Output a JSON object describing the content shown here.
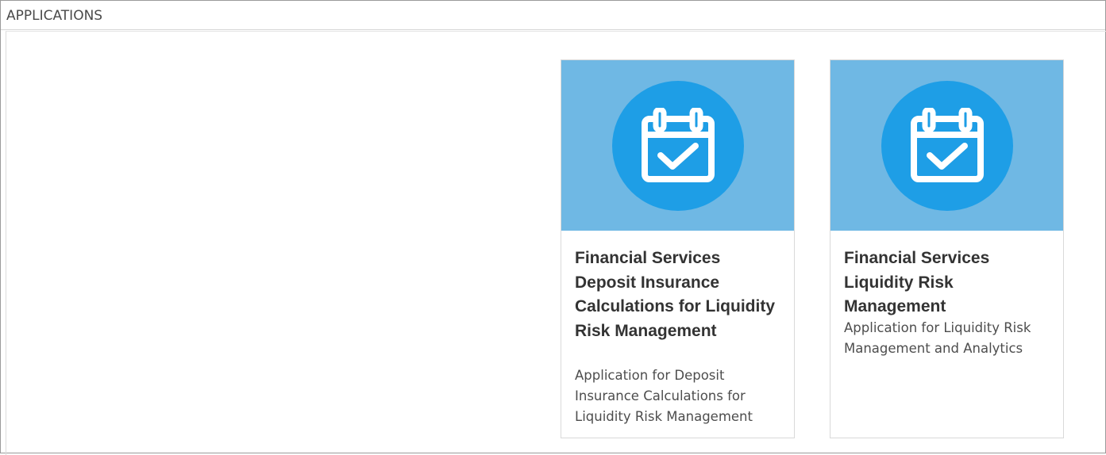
{
  "panel": {
    "title": "APPLICATIONS"
  },
  "applications": [
    {
      "name": "Financial Services Deposit Insurance Calculations for Liquidity Risk Management",
      "description": "Application for Deposit Insurance Calculations for Liquidity Risk Management",
      "icon": "calendar-check-icon"
    },
    {
      "name": "Financial Services Liquidity Risk Management",
      "description": "Application for Liquidity Risk Management and Analytics",
      "icon": "calendar-check-icon"
    }
  ],
  "colors": {
    "banner": "#6fb8e4",
    "icon_circle": "#1e9ee6",
    "title_text": "#333333",
    "description_text": "#4d4d4d"
  }
}
